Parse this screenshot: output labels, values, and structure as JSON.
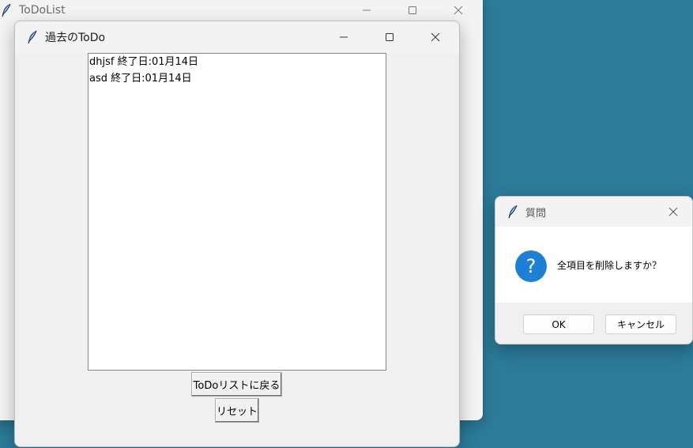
{
  "main_window": {
    "title": "ToDoList"
  },
  "past_window": {
    "title": "過去のToDo",
    "list_items": [
      "dhjsf 終了日:01月14日",
      "asd 終了日:01月14日"
    ],
    "back_button_label": "ToDoリストに戻る",
    "reset_button_label": "リセット"
  },
  "dialog": {
    "title": "質問",
    "icon_glyph": "?",
    "message": "全項目を削除しますか？",
    "ok_label": "OK",
    "cancel_label": "キャンセル"
  },
  "icons": {
    "app_icon": "feather-icon",
    "minimize": "minimize-icon",
    "maximize": "maximize-icon",
    "close": "close-icon",
    "question": "question-icon"
  },
  "colors": {
    "desktop": "#2b7b99",
    "question_icon": "#1e7fd4",
    "window_bg": "#f0f0f0"
  }
}
